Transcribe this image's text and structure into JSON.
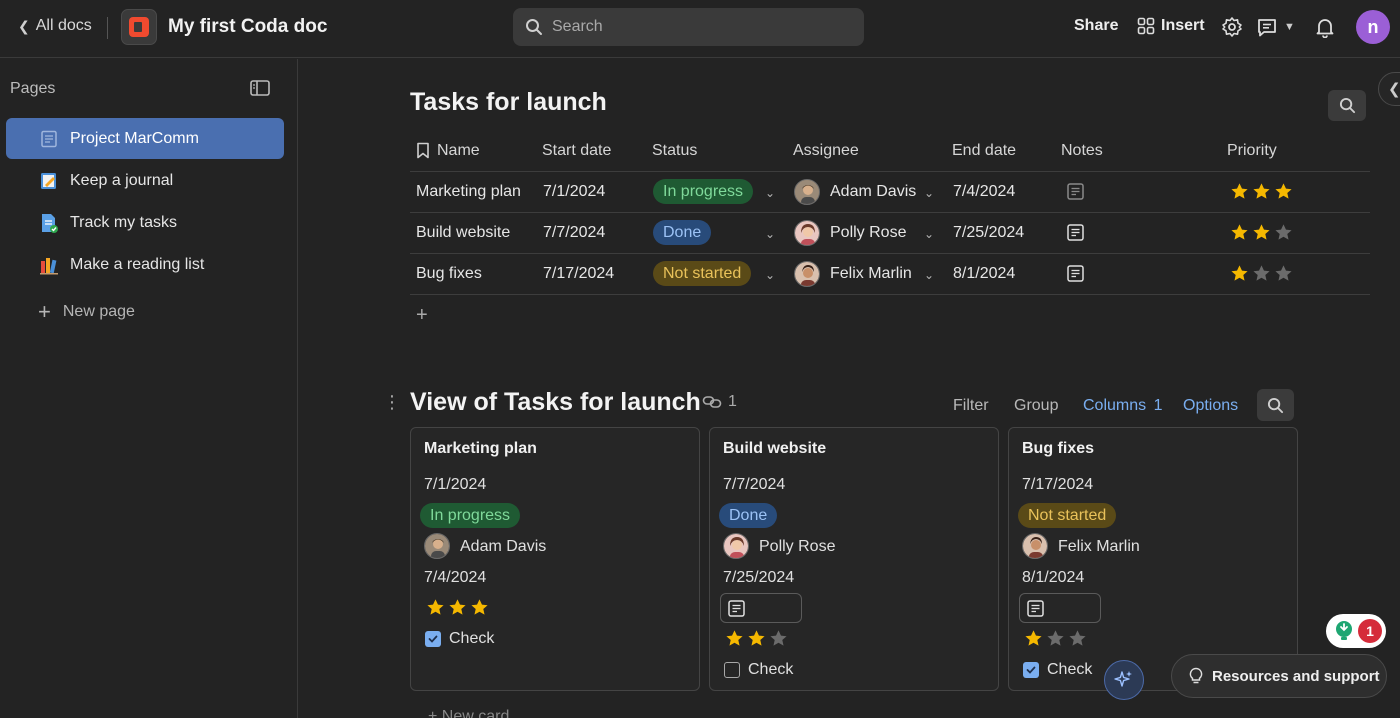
{
  "topbar": {
    "back_label": "All docs",
    "doc_title": "My first Coda doc",
    "search_placeholder": "Search",
    "share_label": "Share",
    "insert_label": "Insert",
    "avatar_initial": "n"
  },
  "sidebar": {
    "header": "Pages",
    "items": [
      {
        "label": "Project MarComm",
        "icon": "page-icon",
        "active": true
      },
      {
        "label": "Keep a journal",
        "icon": "journal-icon"
      },
      {
        "label": "Track my tasks",
        "icon": "tasks-icon"
      },
      {
        "label": "Make a reading list",
        "icon": "books-icon"
      }
    ],
    "new_page_label": "New page"
  },
  "table": {
    "title": "Tasks for launch",
    "columns": [
      "Name",
      "Start date",
      "Status",
      "Assignee",
      "End date",
      "Notes",
      "Priority"
    ],
    "rows": [
      {
        "name": "Marketing plan",
        "start": "7/1/2024",
        "status": "In progress",
        "status_color": "#7fd99a",
        "assignee": "Adam Davis",
        "end": "7/4/2024",
        "priority": 3
      },
      {
        "name": "Build website",
        "start": "7/7/2024",
        "status": "Done",
        "status_color": "#9bc2f5",
        "assignee": "Polly Rose",
        "end": "7/25/2024",
        "priority": 2
      },
      {
        "name": "Bug fixes",
        "start": "7/17/2024",
        "status": "Not started",
        "status_color": "#e9c25a",
        "assignee": "Felix Marlin",
        "end": "8/1/2024",
        "priority": 1
      }
    ]
  },
  "view": {
    "title": "View of Tasks for launch",
    "link_count": "1",
    "filter_label": "Filter",
    "group_label": "Group",
    "columns_label": "Columns",
    "columns_count": "1",
    "options_label": "Options",
    "cards": [
      {
        "title": "Marketing plan",
        "start": "7/1/2024",
        "status": "In progress",
        "assignee": "Adam Davis",
        "end": "7/4/2024",
        "priority": 3,
        "check_label": "Check",
        "checked": true
      },
      {
        "title": "Build website",
        "start": "7/7/2024",
        "status": "Done",
        "assignee": "Polly Rose",
        "end": "7/25/2024",
        "priority": 2,
        "check_label": "Check",
        "checked": false
      },
      {
        "title": "Bug fixes",
        "start": "7/17/2024",
        "status": "Not started",
        "assignee": "Felix Marlin",
        "end": "8/1/2024",
        "priority": 1,
        "check_label": "Check",
        "checked": true
      }
    ],
    "new_card_label": "New card"
  },
  "floating": {
    "resources_label": "Resources and support",
    "notification_count": "1"
  },
  "colors": {
    "accent_blue": "#7aaef0",
    "active_page": "#4a6fb0",
    "star_on": "#f5b800",
    "star_off": "#6b6b6b",
    "logo_red": "#f04a2f"
  }
}
